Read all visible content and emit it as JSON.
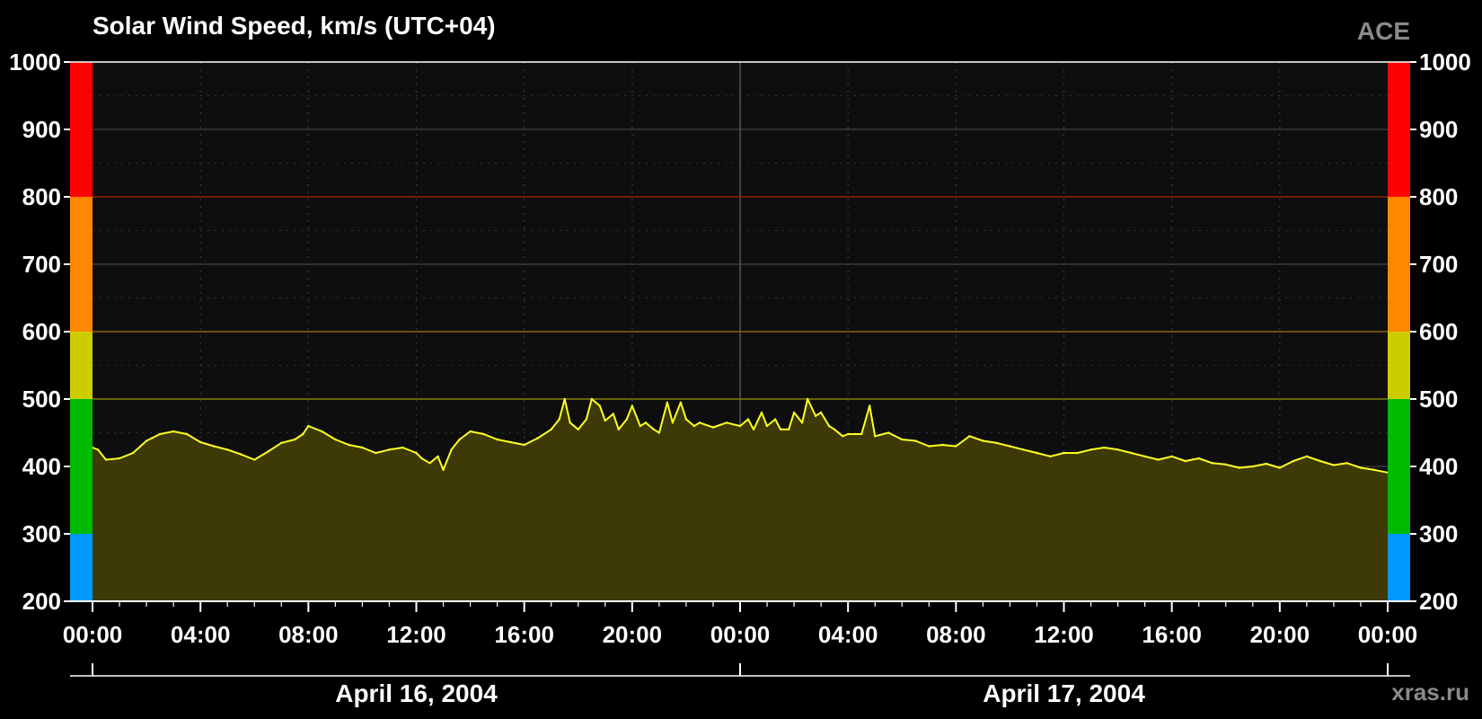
{
  "header": {
    "title": "Solar Wind Speed, km/s (UTC+04)",
    "source": "ACE"
  },
  "footer": {
    "credit": "xras.ru"
  },
  "colors": {
    "background": "#000000",
    "plot_background": "#0e0e0e",
    "line": "#ffff22",
    "fill": "#3d3a05",
    "grid": "#3a3a3a",
    "zone_blue": "#0099ff",
    "zone_green": "#00bb00",
    "zone_yellow": "#cccc00",
    "zone_orange": "#ff8800",
    "zone_red": "#ff0000"
  },
  "chart_data": {
    "type": "area",
    "title": "Solar Wind Speed, km/s (UTC+04)",
    "ylim": [
      200,
      1000
    ],
    "y_ticks": [
      "200",
      "300",
      "400",
      "500",
      "600",
      "700",
      "800",
      "900",
      "1000"
    ],
    "xlim_hours": [
      0,
      48
    ],
    "x_ticks": [
      "00:00",
      "04:00",
      "08:00",
      "12:00",
      "16:00",
      "20:00",
      "00:00",
      "04:00",
      "08:00",
      "12:00",
      "16:00",
      "20:00",
      "00:00"
    ],
    "date_labels": [
      "April 16, 2004",
      "April 17, 2004"
    ],
    "grid": true,
    "threshold_zones": [
      {
        "from": 200,
        "to": 300,
        "color": "#0099ff"
      },
      {
        "from": 300,
        "to": 500,
        "color": "#00bb00"
      },
      {
        "from": 500,
        "to": 600,
        "color": "#cccc00"
      },
      {
        "from": 600,
        "to": 800,
        "color": "#ff8800"
      },
      {
        "from": 800,
        "to": 1000,
        "color": "#ff0000"
      }
    ],
    "threshold_lines": [
      {
        "value": 500,
        "color": "#7a7a00"
      },
      {
        "value": 600,
        "color": "#8a5a00"
      },
      {
        "value": 800,
        "color": "#8a1a00"
      }
    ],
    "series": [
      {
        "x_hours": [
          0,
          0.2,
          0.5,
          1,
          1.5,
          2,
          2.2,
          2.5,
          3,
          3.5,
          4,
          4.5,
          5,
          5.5,
          6,
          6.5,
          7,
          7.5,
          7.8,
          8,
          8.5,
          9,
          9.5,
          10,
          10.5,
          11,
          11.5,
          12,
          12.2,
          12.5,
          12.8,
          13,
          13.3,
          13.6,
          14,
          14.5,
          15,
          15.5,
          16,
          16.5,
          17,
          17.3,
          17.5,
          17.7,
          18,
          18.3,
          18.5,
          18.8,
          19,
          19.3,
          19.5,
          19.8,
          20,
          20.3,
          20.5,
          20.8,
          21,
          21.3,
          21.5,
          21.8,
          22,
          22.3,
          22.5,
          23,
          23.5,
          24,
          24.3,
          24.5,
          24.8,
          25,
          25.3,
          25.5,
          25.8,
          26,
          26.3,
          26.5,
          26.8,
          27,
          27.3,
          27.5,
          27.8,
          28,
          28.5,
          28.8,
          29,
          29.5,
          30,
          30.5,
          31,
          31.5,
          32,
          32.5,
          33,
          33.5,
          34,
          34.5,
          35,
          35.5,
          36,
          36.5,
          37,
          37.5,
          38,
          38.5,
          39,
          39.5,
          40,
          40.5,
          41,
          41.5,
          42,
          42.5,
          43,
          43.5,
          44,
          44.5,
          45,
          45.5,
          46,
          46.5,
          47,
          47.5,
          48
        ],
        "values": [
          428,
          425,
          410,
          412,
          420,
          438,
          442,
          448,
          452,
          448,
          436,
          430,
          425,
          418,
          410,
          422,
          435,
          440,
          448,
          460,
          452,
          440,
          432,
          428,
          420,
          425,
          428,
          420,
          412,
          405,
          415,
          395,
          425,
          440,
          452,
          448,
          440,
          436,
          432,
          442,
          455,
          470,
          500,
          465,
          455,
          470,
          500,
          490,
          468,
          478,
          455,
          470,
          490,
          460,
          465,
          455,
          450,
          495,
          465,
          495,
          470,
          460,
          465,
          458,
          465,
          460,
          470,
          455,
          480,
          460,
          470,
          455,
          455,
          480,
          465,
          500,
          475,
          480,
          460,
          455,
          445,
          448,
          448,
          490,
          445,
          450,
          440,
          438,
          430,
          432,
          430,
          445,
          438,
          435,
          430,
          425,
          420,
          415,
          420,
          420,
          425,
          428,
          425,
          420,
          415,
          410,
          415,
          408,
          412,
          405,
          403,
          398,
          400,
          404,
          398,
          408,
          415,
          408,
          402,
          405,
          398,
          395,
          391
        ]
      }
    ]
  }
}
